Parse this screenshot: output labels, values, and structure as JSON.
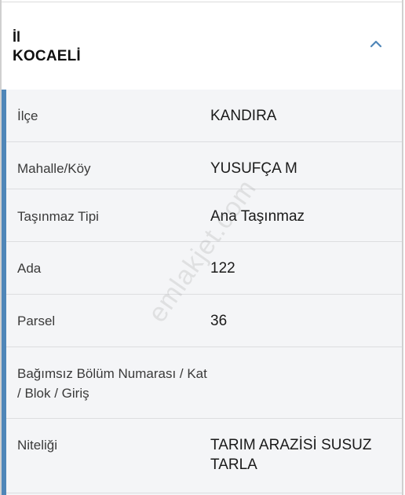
{
  "header": {
    "label": "İl",
    "value": "KOCAELİ",
    "toggle_icon": "chevron-up-icon",
    "accent_color": "#4f86b8"
  },
  "rows": [
    {
      "label": "İlçe",
      "value": "KANDIRA"
    },
    {
      "label": "Mahalle/Köy",
      "value": "YUSUFÇA M"
    },
    {
      "label": "Taşınmaz Tipi",
      "value": "Ana Taşınmaz"
    },
    {
      "label": "Ada",
      "value": "122"
    },
    {
      "label": "Parsel",
      "value": "36"
    },
    {
      "label": "Bağımsız Bölüm Numarası / Kat / Blok / Giriş",
      "value": ""
    },
    {
      "label": "Niteliği",
      "value": "TARIM ARAZİSİ SUSUZ TARLA"
    }
  ],
  "watermark": "emlakjet.com"
}
